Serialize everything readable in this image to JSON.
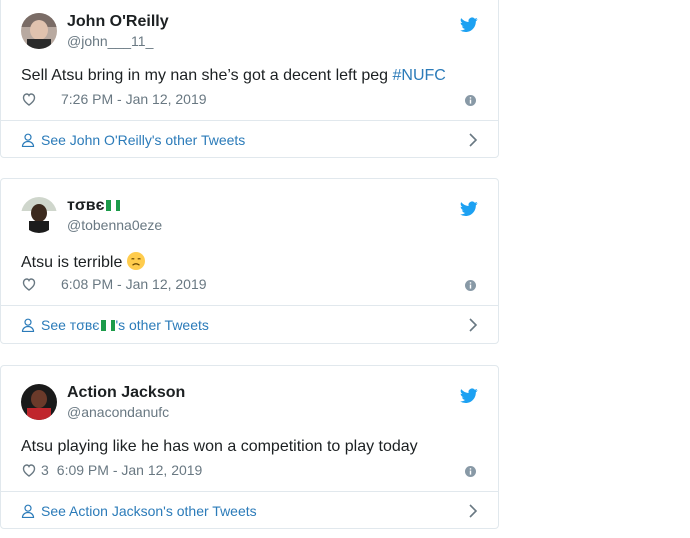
{
  "tweets": [
    {
      "name": "John O'Reilly",
      "handle": "@john___11_",
      "text": "Sell Atsu bring in my nan she’s got a decent left peg ",
      "hashtag": "#NUFC",
      "likes": "",
      "timestamp": "7:26 PM - Jan 12, 2019",
      "footer": "See John O'Reilly's other Tweets"
    },
    {
      "name": "ᴛσʙє",
      "handle": "@tobenna0eze",
      "text": "Atsu is terrible",
      "likes": "",
      "timestamp": "6:08 PM - Jan 12, 2019",
      "footer_prefix": "See ᴛσʙє",
      "footer_suffix": "'s other Tweets"
    },
    {
      "name": "Action Jackson",
      "handle": "@anacondanufc",
      "text": "Atsu playing like he has won a competition to play today",
      "likes": "3",
      "timestamp": "6:09 PM - Jan 12, 2019",
      "footer": "See Action Jackson's other Tweets"
    }
  ],
  "icons": {
    "bird": "twitter-bird-icon",
    "heart": "heart-icon",
    "info": "info-icon",
    "person": "person-icon",
    "chevron": "chevron-right-icon",
    "flag": "nigeria-flag-emoji",
    "sad": "disappointed-face-emoji"
  },
  "colors": {
    "brand": "#1da1f2",
    "link": "#2b7bb9",
    "muted": "#697882",
    "border": "#e1e8ed"
  }
}
